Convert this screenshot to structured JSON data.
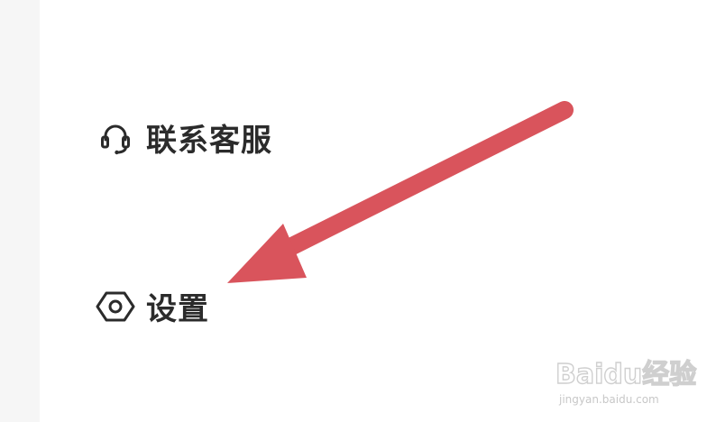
{
  "menu": {
    "items": [
      {
        "label": "联系客服",
        "icon": "headset-icon"
      },
      {
        "label": "设置",
        "icon": "settings-hexagon-icon"
      }
    ]
  },
  "annotation": {
    "arrow_color": "#d9545c"
  },
  "watermark": {
    "brand": "Baidu经验",
    "url": "jingyan.baidu.com"
  }
}
